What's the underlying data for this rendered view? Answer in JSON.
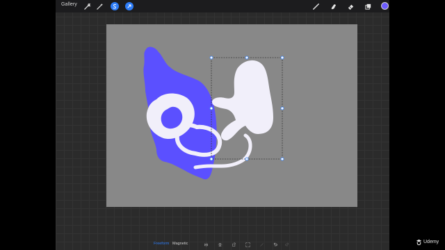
{
  "topbar": {
    "gallery_label": "Gallery",
    "left_tools": [
      {
        "icon": "wrench-icon",
        "active": false
      },
      {
        "icon": "magic-wand-icon",
        "active": false
      },
      {
        "icon": "selection-icon",
        "active": true
      },
      {
        "icon": "transform-arrow-icon",
        "active": true
      }
    ],
    "right_tools": [
      {
        "icon": "brush-icon"
      },
      {
        "icon": "smudge-icon"
      },
      {
        "icon": "eraser-icon"
      },
      {
        "icon": "layers-icon"
      }
    ],
    "current_color": "#6d5cff"
  },
  "bottombar": {
    "freeform_label": "Freeform",
    "magnetic_label": "Magnetic",
    "active_mode": "Freeform",
    "active_color": "#2d7cf6",
    "tools": [
      "flip-horizontal-icon",
      "flip-vertical-icon",
      "rotate-icon",
      "fit-to-screen-icon",
      "interpolation-icon",
      "undo-icon",
      "redo-icon"
    ]
  },
  "canvas": {
    "background": "#888888",
    "shape_colors": {
      "blue": "#5b50ff",
      "white": "#f1effa"
    }
  },
  "watermark": {
    "text": "Udemy"
  }
}
